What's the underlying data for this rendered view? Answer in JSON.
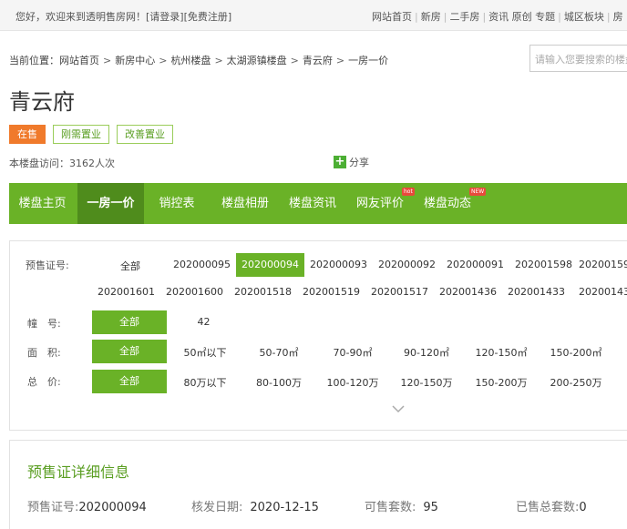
{
  "topbar": {
    "welcome": "您好，欢迎来到透明售房网！",
    "login": "[请登录]",
    "register": "[免费注册]",
    "links": [
      "网站首页",
      "新房",
      "二手房",
      "资讯 原创 专题",
      "城区板块",
      "房"
    ]
  },
  "breadcrumb": {
    "prefix": "当前位置：",
    "items": [
      "网站首页",
      "新房中心",
      "杭州楼盘",
      "太湖源镇楼盘",
      "青云府",
      "一房一价"
    ]
  },
  "search": {
    "placeholder": "请输入您要搜索的楼盘"
  },
  "project": {
    "name": "青云府",
    "tags": [
      "在售",
      "刚需置业",
      "改善置业"
    ],
    "visits": "本楼盘访问：3162人次",
    "share": "分享"
  },
  "nav": {
    "items": [
      "楼盘主页",
      "一房一价",
      "销控表",
      "楼盘相册",
      "楼盘资讯",
      "网友评价",
      "楼盘动态"
    ],
    "badges": {
      "reviews": "hot",
      "news": "NEW"
    }
  },
  "filters": {
    "permit_label": "预售证号:",
    "permits_row1": [
      "全部",
      "202000095",
      "202000094",
      "202000093",
      "202000092",
      "202000091",
      "202001598",
      "20200159"
    ],
    "permits_row2": [
      "202001601",
      "202001600",
      "202001518",
      "202001519",
      "202001517",
      "202001436",
      "202001433",
      "20200143"
    ],
    "selected_permit": "202000094",
    "building_label": "幢　号:",
    "buildings": [
      "全部",
      "42"
    ],
    "area_label": "面　积:",
    "areas": [
      "全部",
      "50㎡以下",
      "50-70㎡",
      "70-90㎡",
      "90-120㎡",
      "120-150㎡",
      "150-200㎡"
    ],
    "price_label": "总　价:",
    "prices": [
      "全部",
      "80万以下",
      "80-100万",
      "100-120万",
      "120-150万",
      "150-200万",
      "200-250万"
    ]
  },
  "detail": {
    "title": "预售证详细信息",
    "permit_no_label": "预售证号:",
    "permit_no": "202000094",
    "issue_date_label": "核发日期:",
    "issue_date": "2020-12-15",
    "available_label": "可售套数:",
    "available": "95",
    "sold_label": "已售总套数:",
    "sold": "0"
  },
  "colors": {
    "brand_green": "#6ab227",
    "active_green": "#4f8c1c",
    "sale_orange": "#f07a2b"
  }
}
